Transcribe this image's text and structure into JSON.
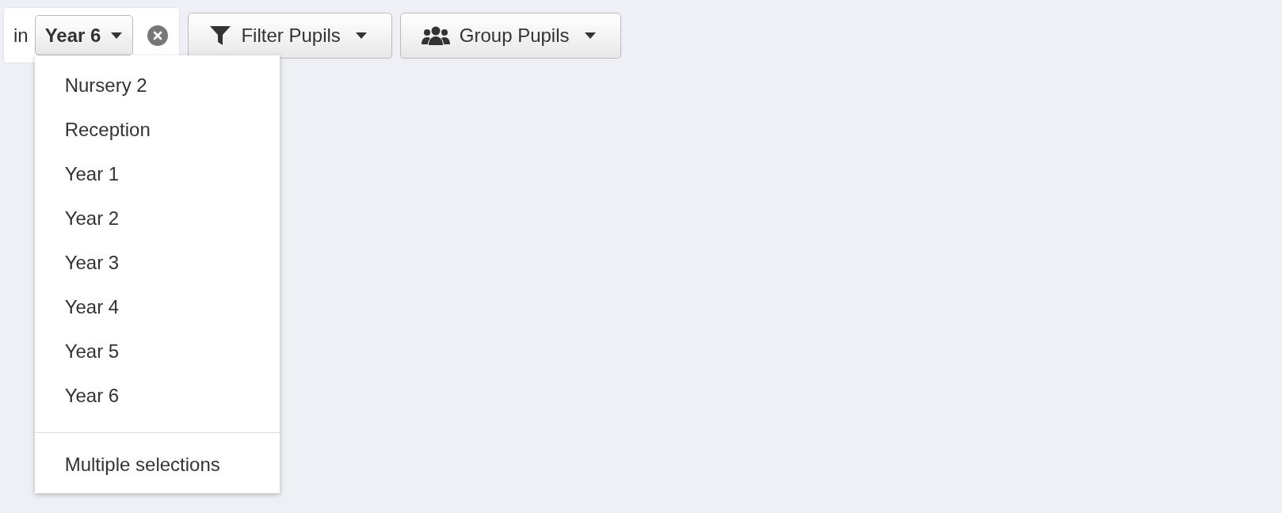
{
  "filter": {
    "prefix": "in",
    "value": "Year 6"
  },
  "buttons": [
    {
      "label": "Filter Pupils",
      "kind": "filter"
    },
    {
      "label": "Group Pupils",
      "kind": "group"
    }
  ],
  "menu": {
    "items": [
      "Nursery 2",
      "Reception",
      "Year 1",
      "Year 2",
      "Year 3",
      "Year 4",
      "Year 5",
      "Year 6"
    ],
    "footer": "Multiple selections"
  }
}
